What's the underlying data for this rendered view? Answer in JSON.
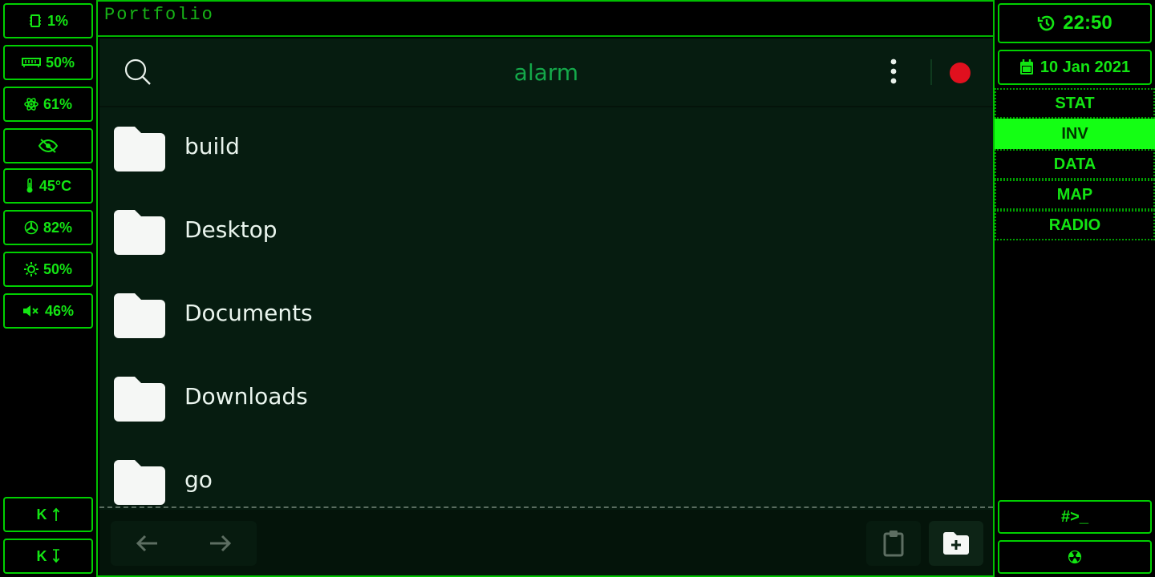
{
  "left_stats": [
    {
      "icon": "cpu-icon",
      "value": "1%"
    },
    {
      "icon": "memory-icon",
      "value": "50%"
    },
    {
      "icon": "atom-icon",
      "value": "61%"
    },
    {
      "icon": "eye-slash-icon",
      "value": ""
    },
    {
      "icon": "thermometer-icon",
      "value": "45°C"
    },
    {
      "icon": "fan-icon",
      "value": "82%"
    },
    {
      "icon": "brightness-icon",
      "value": "50%"
    },
    {
      "icon": "volume-mute-icon",
      "value": "46%"
    }
  ],
  "keyboard_buttons": [
    {
      "label": "K",
      "icon": "arrow-up-icon"
    },
    {
      "label": "K",
      "icon": "arrow-down-icon"
    }
  ],
  "window": {
    "title": "Portfolio"
  },
  "app": {
    "header_title": "alarm",
    "folders": [
      "build",
      "Desktop",
      "Documents",
      "Downloads",
      "go"
    ]
  },
  "right": {
    "time": "22:50",
    "date": "10 Jan 2021",
    "tabs": [
      "STAT",
      "INV",
      "DATA",
      "MAP",
      "RADIO"
    ],
    "active_tab": "INV",
    "terminal_label": "#>_"
  },
  "colors": {
    "accent": "#13e513",
    "app_background": "#061c10",
    "record": "#e0101e",
    "title_green": "#14a84a"
  }
}
